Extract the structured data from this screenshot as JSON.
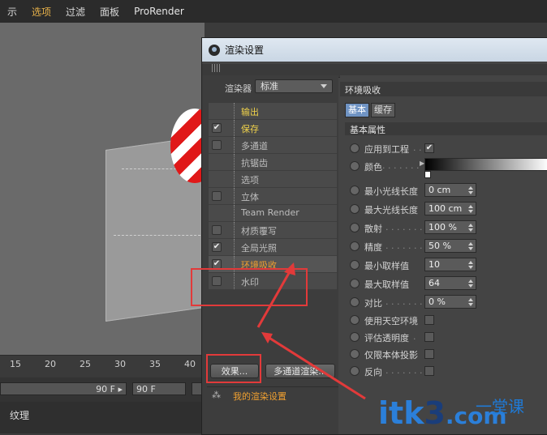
{
  "menubar": {
    "items": [
      "示",
      "选项",
      "过滤",
      "面板",
      "ProRender"
    ]
  },
  "timeline": {
    "ticks": [
      "15",
      "20",
      "25",
      "30",
      "35",
      "40"
    ],
    "frame_a": "90 F",
    "frame_b": "90 F"
  },
  "bottom_panel": {
    "label": "纹理"
  },
  "dialog": {
    "title": "渲染设置",
    "renderer_label": "渲染器",
    "renderer_value": "标准",
    "items": [
      {
        "label": "输出",
        "checkbox": false,
        "checked": false
      },
      {
        "label": "保存",
        "checkbox": true,
        "checked": true
      },
      {
        "label": "多通道",
        "checkbox": true,
        "checked": false
      },
      {
        "label": "抗锯齿",
        "checkbox": false,
        "checked": false
      },
      {
        "label": "选项",
        "checkbox": false,
        "checked": false
      },
      {
        "label": "立体",
        "checkbox": true,
        "checked": false
      },
      {
        "label": "Team Render",
        "checkbox": false,
        "checked": false
      },
      {
        "label": "材质覆写",
        "checkbox": true,
        "checked": false
      },
      {
        "label": "全局光照",
        "checkbox": true,
        "checked": true
      },
      {
        "label": "环境吸收",
        "checkbox": true,
        "checked": true
      },
      {
        "label": "水印",
        "checkbox": true,
        "checked": false
      }
    ],
    "effects_button": "效果...",
    "multipass_button": "多通道渲染...",
    "preset_label": "我的渲染设置",
    "section_title": "环境吸收",
    "tab_basic": "基本",
    "tab_cache": "缓存",
    "group_title": "基本属性",
    "props": {
      "apply": "应用到工程",
      "color": "颜色",
      "min_ray": "最小光线长度",
      "min_ray_val": "0 cm",
      "max_ray": "最大光线长度",
      "max_ray_val": "100 cm",
      "spread": "散射",
      "spread_val": "100 %",
      "accuracy": "精度",
      "accuracy_val": "50 %",
      "min_samples": "最小取样值",
      "min_samples_val": "10",
      "max_samples": "最大取样值",
      "max_samples_val": "64",
      "contrast": "对比",
      "contrast_val": "0 %",
      "use_sky": "使用天空环境",
      "eval_transparency": "评估透明度",
      "self_shadow": "仅限本体投影",
      "invert": "反向"
    },
    "checkmark": "✔"
  },
  "watermark": {
    "text_a": "itk",
    "text_b": "3",
    "text_c": ".com",
    "sub": "一堂课"
  },
  "colors": {
    "highlight_box": "#e23a3a",
    "accent_yellow": "#f0d24a",
    "accent_orange": "#f0a030",
    "tab_blue": "#6f93c3"
  }
}
